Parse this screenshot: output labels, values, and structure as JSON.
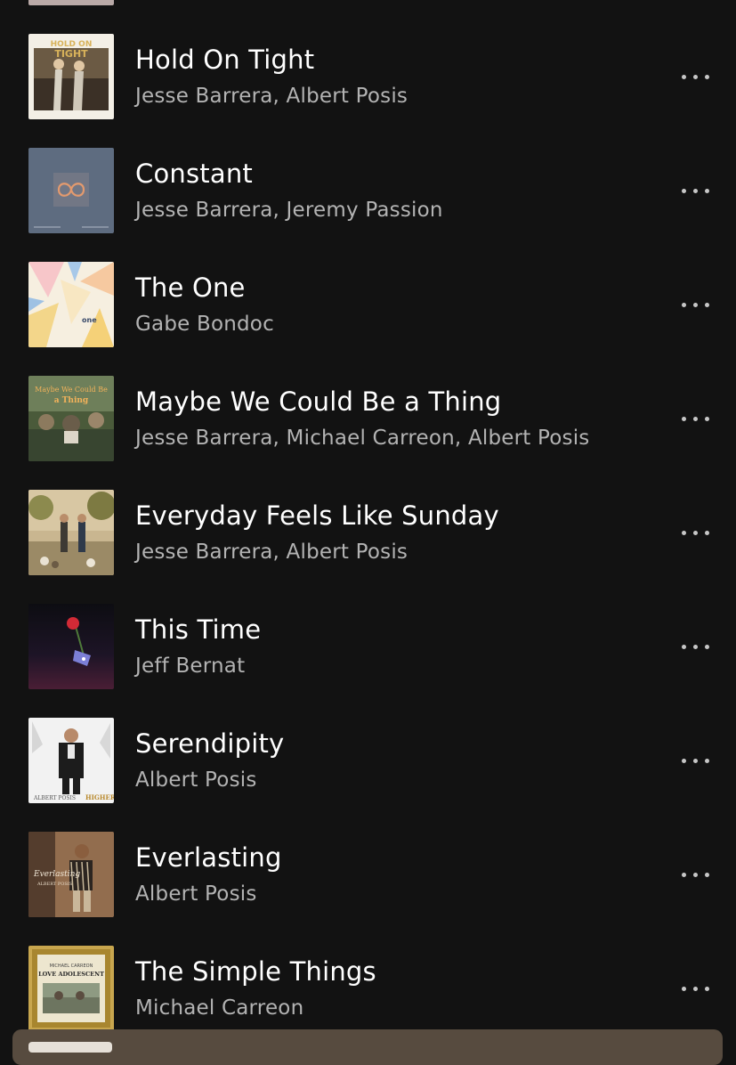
{
  "tracks": [
    {
      "title": "Hold On Tight",
      "artists": "Jesse Barrera, Albert Posis",
      "cover_name": "cover-hold-on-tight",
      "cover_text": "HOLD ON TIGHT",
      "more_icon": "more-horizontal-icon"
    },
    {
      "title": "Constant",
      "artists": "Jesse Barrera, Jeremy Passion",
      "cover_name": "cover-constant",
      "more_icon": "more-horizontal-icon"
    },
    {
      "title": "The One",
      "artists": "Gabe Bondoc",
      "cover_name": "cover-the-one",
      "cover_text": "one",
      "more_icon": "more-horizontal-icon"
    },
    {
      "title": "Maybe We Could Be a Thing",
      "artists": "Jesse Barrera, Michael Carreon, Albert Posis",
      "cover_name": "cover-maybe-we-could-be-a-thing",
      "cover_text": "Maybe We Could Be a Thing",
      "more_icon": "more-horizontal-icon"
    },
    {
      "title": "Everyday Feels Like Sunday",
      "artists": "Jesse Barrera, Albert Posis",
      "cover_name": "cover-everyday-feels-like-sunday",
      "more_icon": "more-horizontal-icon"
    },
    {
      "title": "This Time",
      "artists": "Jeff Bernat",
      "cover_name": "cover-this-time",
      "more_icon": "more-horizontal-icon"
    },
    {
      "title": "Serendipity",
      "artists": "Albert Posis",
      "cover_name": "cover-serendipity",
      "cover_text": "ALBERT POSIS HIGHER",
      "more_icon": "more-horizontal-icon"
    },
    {
      "title": "Everlasting",
      "artists": "Albert Posis",
      "cover_name": "cover-everlasting",
      "cover_text": "Everlasting ALBERT POSIS",
      "more_icon": "more-horizontal-icon"
    },
    {
      "title": "The Simple Things",
      "artists": "Michael Carreon",
      "cover_name": "cover-the-simple-things",
      "cover_text": "MICHAEL CARREON LOVE ADOLESCENT",
      "more_icon": "more-horizontal-icon"
    }
  ],
  "colors": {
    "background": "#121212",
    "title": "#ffffff",
    "subtitle": "#b3b3b3",
    "mini_player": "#574b3f"
  }
}
